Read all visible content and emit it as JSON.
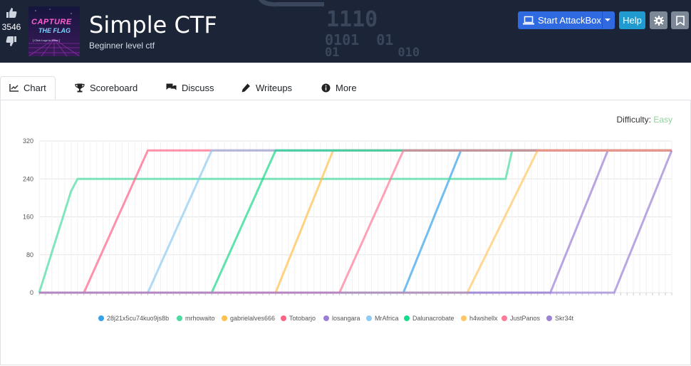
{
  "room": {
    "title": "Simple CTF",
    "subtitle": "Beginner level ctf",
    "votes": "3546",
    "logo_text_1": "CAPTURE",
    "logo_text_2": "THE FLAG",
    "logo_text_3": "[ Click Logo to Enter ]"
  },
  "header_bg_binary": [
    "1110",
    "0101  01",
    "01        010"
  ],
  "buttons": {
    "attackbox": "Start AttackBox",
    "help": "Help"
  },
  "tabs": [
    {
      "label": "Chart",
      "icon": "chart-icon"
    },
    {
      "label": "Scoreboard",
      "icon": "trophy-icon"
    },
    {
      "label": "Discuss",
      "icon": "comments-icon"
    },
    {
      "label": "Writeups",
      "icon": "pen-icon"
    },
    {
      "label": "More",
      "icon": "info-icon"
    }
  ],
  "difficulty": {
    "label": "Difficulty:",
    "value": "Easy",
    "color": "#8fd19e"
  },
  "chart_data": {
    "type": "line",
    "ylim": [
      0,
      320
    ],
    "yticks": [
      0,
      80,
      160,
      240,
      320
    ],
    "grid": true,
    "legend_position": "bottom",
    "x_count": 100,
    "series": [
      {
        "name": "28j21x5cu74kuo9js8b",
        "color": "#36a2eb",
        "start": 57,
        "end": 66,
        "plateaus": []
      },
      {
        "name": "mrhowaito",
        "color": "#4bdba3",
        "start": 0,
        "end": 7,
        "plateaus": [
          {
            "v": 240,
            "until": 74
          }
        ]
      },
      {
        "name": "gabrielalves666",
        "color": "#ffc04d",
        "start": 37,
        "end": 46,
        "plateaus": []
      },
      {
        "name": "Totobarjo",
        "color": "#ff6384",
        "start": 7,
        "end": 17,
        "plateaus": []
      },
      {
        "name": "losangara",
        "color": "#9b7fd6",
        "start": 80,
        "end": 89,
        "plateaus": []
      },
      {
        "name": "MrAfrica",
        "color": "#8fcbf2",
        "start": 17,
        "end": 27,
        "plateaus": []
      },
      {
        "name": "Dalunacrobate",
        "color": "#19d98a",
        "start": 27,
        "end": 37,
        "plateaus": []
      },
      {
        "name": "h4wshellx",
        "color": "#ffc766",
        "start": 67,
        "end": 78,
        "plateaus": [
          {
            "v": 180,
            "until": 74
          }
        ]
      },
      {
        "name": "JustPanos",
        "color": "#ff7a96",
        "start": 47,
        "end": 57,
        "plateaus": []
      },
      {
        "name": "Skr34t",
        "color": "#9a82d4",
        "start": 90,
        "end": 99,
        "plateaus": []
      }
    ]
  }
}
